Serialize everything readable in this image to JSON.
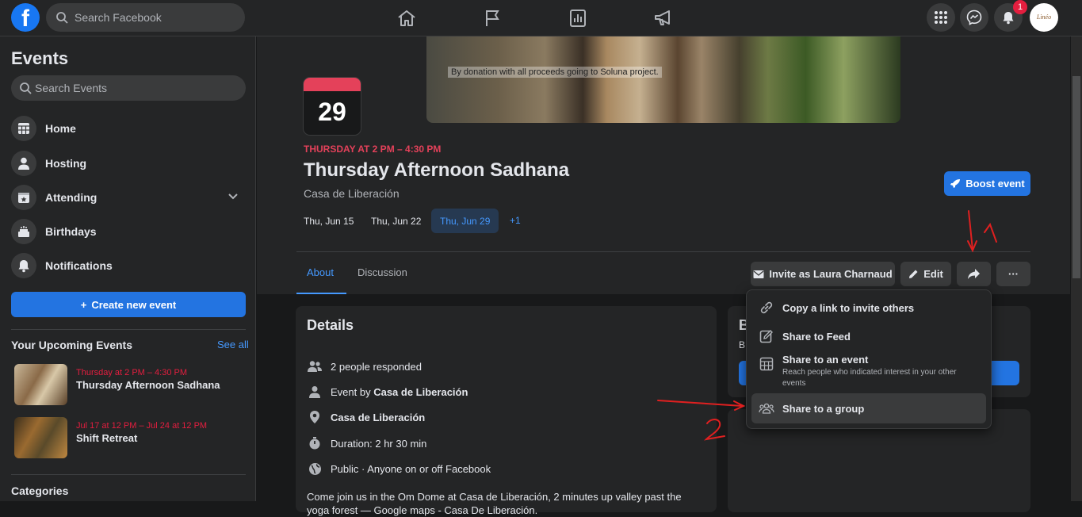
{
  "topbar": {
    "logo": "f",
    "search_placeholder": "Search Facebook",
    "notification_count": "1",
    "avatar_text": "Lìnéo"
  },
  "sidebar": {
    "title": "Events",
    "search_placeholder": "Search Events",
    "items": [
      {
        "label": "Home",
        "icon": "calendar-grid-icon"
      },
      {
        "label": "Hosting",
        "icon": "person-icon"
      },
      {
        "label": "Attending",
        "icon": "calendar-star-icon"
      },
      {
        "label": "Birthdays",
        "icon": "cake-icon"
      },
      {
        "label": "Notifications",
        "icon": "bell-icon"
      }
    ],
    "create_button": "Create new event",
    "upcoming_title": "Your Upcoming Events",
    "see_all": "See all",
    "upcoming": [
      {
        "date": "Thursday at 2 PM – 4:30 PM",
        "name": "Thursday Afternoon Sadhana"
      },
      {
        "date": "Jul 17 at 12 PM – Jul 24 at 12 PM",
        "name": "Shift Retreat"
      }
    ],
    "categories_title": "Categories"
  },
  "event": {
    "cover_caption": "By donation with  all proceeds going to Soluna project.",
    "calendar_day": "29",
    "time": "THURSDAY AT 2 PM – 4:30 PM",
    "title": "Thursday Afternoon Sadhana",
    "host": "Casa de Liberación",
    "dates": [
      "Thu, Jun 15",
      "Thu, Jun 22",
      "Thu, Jun 29"
    ],
    "dates_more": "+1",
    "boost_label": "Boost event"
  },
  "tabs": {
    "about": "About",
    "discussion": "Discussion"
  },
  "actions": {
    "invite_label": "Invite as Laura Charnaud",
    "edit_label": "Edit",
    "more_label": "···"
  },
  "details": {
    "title": "Details",
    "responded": "2 people responded",
    "event_by_prefix": "Event by ",
    "event_by_name": "Casa de Liberación",
    "location": "Casa de Liberación",
    "duration": "Duration: 2 hr 30 min",
    "privacy": "Public · Anyone on or off Facebook",
    "description": "Come join us in the Om Dome at Casa de Liberación, 2 minutes up valley past the yoga forest — Google maps - Casa De Liberación."
  },
  "side_card": {
    "heading": "B",
    "line": "B"
  },
  "share_menu": {
    "items": [
      {
        "label": "Copy a link to invite others",
        "icon": "link-icon"
      },
      {
        "label": "Share to Feed",
        "icon": "compose-icon"
      },
      {
        "label": "Share to an event",
        "sub": "Reach people who indicated interest in your other events",
        "icon": "calendar-grid-icon"
      },
      {
        "label": "Share to a group",
        "icon": "group-icon"
      }
    ]
  },
  "annotations": {
    "mark1": "1",
    "mark2": "2",
    "color": "#e02020"
  },
  "colors": {
    "accent": "#2374e1",
    "link": "#4599ff",
    "event_red": "#e4415a",
    "background": "#18191a",
    "surface": "#242526"
  }
}
